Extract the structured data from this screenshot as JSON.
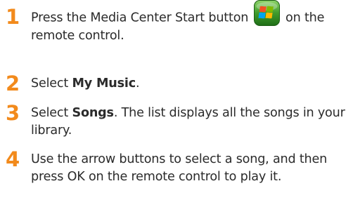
{
  "steps": [
    {
      "number": "1",
      "text_before": "Press the Media Center Start button",
      "icon": "windows-start-button-icon",
      "text_after": "on the remote control."
    },
    {
      "number": "2",
      "text_before": "Select ",
      "bold": "My Music",
      "text_after": "."
    },
    {
      "number": "3",
      "text_before": "Select ",
      "bold": "Songs",
      "text_after": ". The list displays all the songs in your library."
    },
    {
      "number": "4",
      "text_before": "Use the arrow buttons to select a song, and then press OK on the remote control to play it."
    }
  ],
  "colors": {
    "step_number": "#f28a1c",
    "text": "#2b2b2b",
    "start_button_green": "#3f9b2c"
  }
}
